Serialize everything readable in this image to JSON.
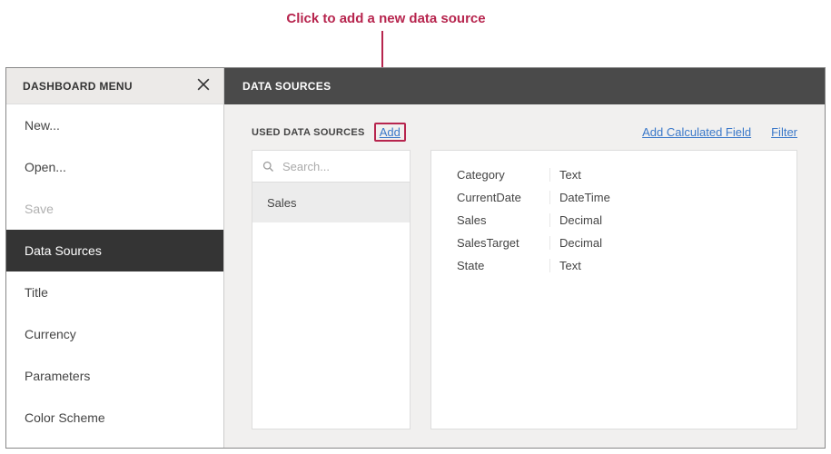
{
  "annotation": {
    "text": "Click to add a new data source"
  },
  "sidebar": {
    "title": "DASHBOARD MENU",
    "items": [
      {
        "label": "New...",
        "state": ""
      },
      {
        "label": "Open...",
        "state": ""
      },
      {
        "label": "Save",
        "state": "disabled"
      },
      {
        "label": "Data Sources",
        "state": "active"
      },
      {
        "label": "Title",
        "state": ""
      },
      {
        "label": "Currency",
        "state": ""
      },
      {
        "label": "Parameters",
        "state": ""
      },
      {
        "label": "Color Scheme",
        "state": ""
      }
    ]
  },
  "content": {
    "header": "DATA SOURCES",
    "toolbar": {
      "label": "USED DATA SOURCES",
      "add": "Add",
      "calc": "Add Calculated Field",
      "filter": "Filter"
    },
    "search": {
      "placeholder": "Search..."
    },
    "sources": [
      {
        "name": "Sales"
      }
    ],
    "fields": [
      {
        "name": "Category",
        "type": "Text"
      },
      {
        "name": "CurrentDate",
        "type": "DateTime"
      },
      {
        "name": "Sales",
        "type": "Decimal"
      },
      {
        "name": "SalesTarget",
        "type": "Decimal"
      },
      {
        "name": "State",
        "type": "Text"
      }
    ]
  }
}
